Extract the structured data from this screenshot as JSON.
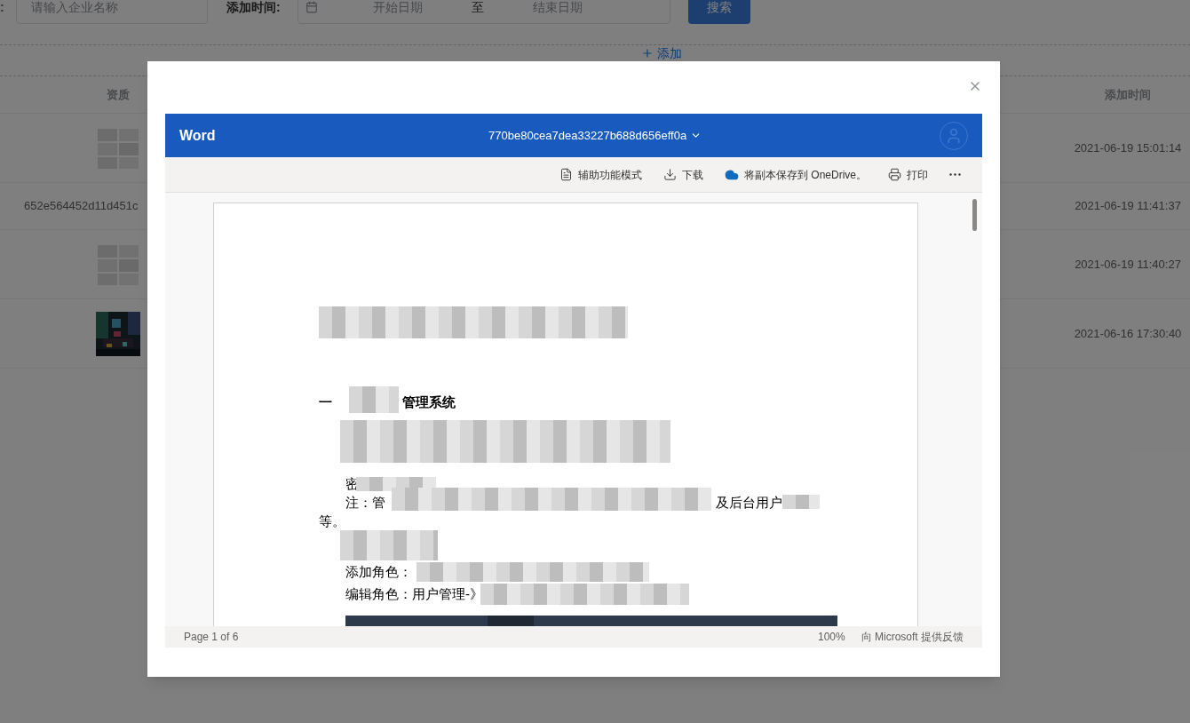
{
  "filter": {
    "name_label": ":",
    "name_placeholder": "请输入企业名称",
    "time_label": "添加时间:",
    "start_placeholder": "开始日期",
    "range_separator": "至",
    "end_placeholder": "结束日期",
    "search_button": "搜索"
  },
  "add_button": "添加",
  "table": {
    "columns": [
      "资质",
      "添加时间"
    ],
    "rows": [
      {
        "kind": "thumbnail",
        "added": "2021-06-19 15:01:14"
      },
      {
        "kind": "text",
        "qualification": "652e564452d11d451c",
        "added": "2021-06-19 11:41:37"
      },
      {
        "kind": "thumbnail",
        "added": "2021-06-19 11:40:27"
      },
      {
        "kind": "picture",
        "added": "2021-06-16 17:30:40"
      }
    ]
  },
  "dialog": {
    "viewer": {
      "app_name": "Word",
      "file_name": "770be80cea7dea33227b688d656eff0a",
      "toolbar": [
        {
          "kind": "accessibility",
          "label": "辅助功能模式"
        },
        {
          "kind": "download",
          "label": "下载"
        },
        {
          "kind": "onedrive",
          "label": "将副本保存到 OneDrive。"
        },
        {
          "kind": "print",
          "label": "打印"
        },
        {
          "kind": "more"
        }
      ],
      "document": {
        "lines": [
          {
            "parts": [
              "一",
              "管理系统"
            ],
            "bold": true,
            "indent": false
          },
          {
            "parts": [
              "密"
            ],
            "bold": false,
            "indent": true
          },
          {
            "parts": [
              "注：管",
              "及后台用户"
            ],
            "bold": false,
            "indent": true
          },
          {
            "parts": [
              "等。"
            ],
            "bold": false,
            "indent": false
          },
          {
            "parts": [
              "添加角色："
            ],
            "bold": false,
            "indent": true
          },
          {
            "parts": [
              "编辑角色：用户管理-》"
            ],
            "bold": false,
            "indent": true
          }
        ]
      },
      "status": {
        "page": "Page 1 of 6",
        "zoom": "100%",
        "feedback": "向 Microsoft 提供反馈"
      }
    }
  }
}
